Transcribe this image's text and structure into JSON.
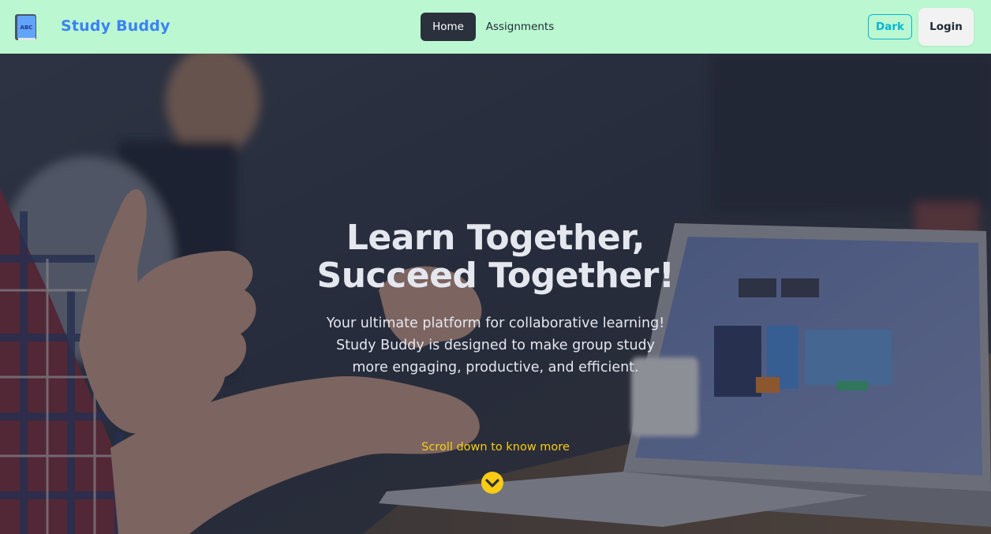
{
  "header": {
    "logo_icon": "book-abc-icon",
    "logo_text": "ABC",
    "brand": "Study Buddy",
    "nav": {
      "home": "Home",
      "assignments": "Assignments"
    },
    "theme_toggle": "Dark",
    "login": "Login"
  },
  "hero": {
    "title_line1": "Learn Together,",
    "title_line2": "Succeed Together!",
    "subtitle_line1": "Your ultimate platform for collaborative learning!",
    "subtitle_line2": "Study Buddy is designed to make group study",
    "subtitle_line3": "more engaging, productive, and efficient.",
    "scroll_text": "Scroll down to know more",
    "scroll_icon": "chevron-down-circle-icon"
  },
  "colors": {
    "navbar_bg": "#bbf7d0",
    "brand": "#3b82f6",
    "active_nav_bg": "#2a303c",
    "dark_button": "#06b6d4",
    "scroll_accent": "#facc15"
  }
}
